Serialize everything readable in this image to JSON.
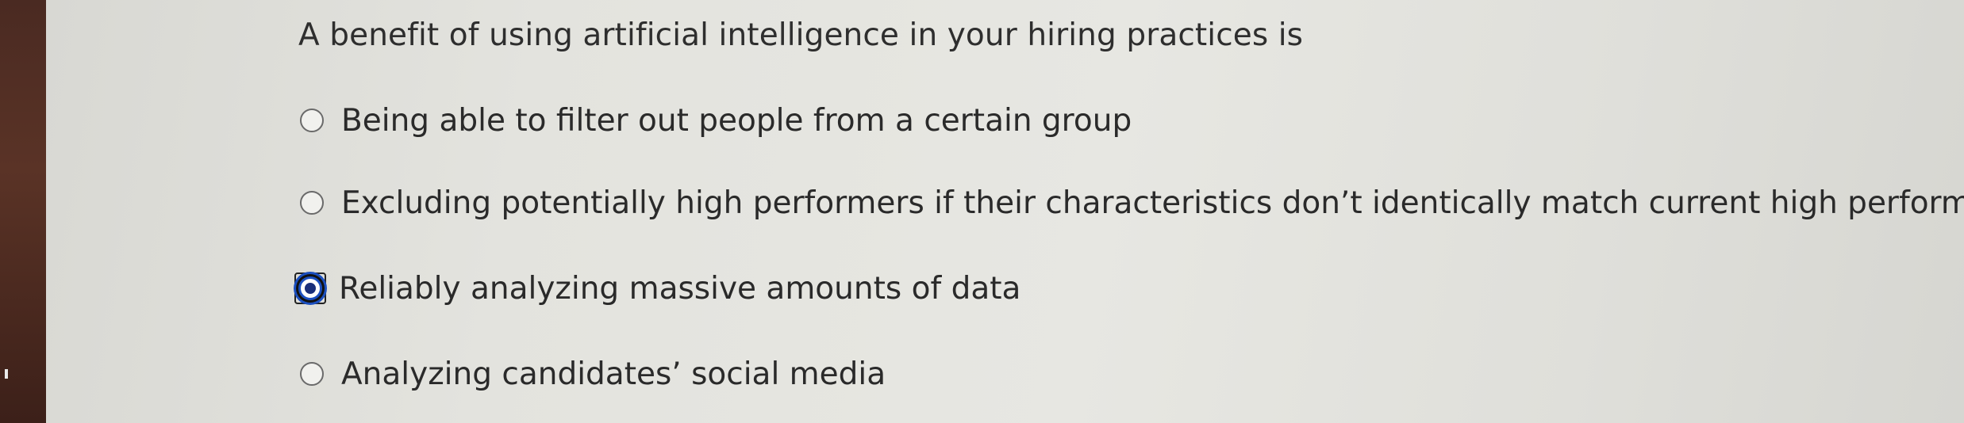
{
  "question": {
    "text": "A benefit of using artificial intelligence in your hiring practices is"
  },
  "options": [
    {
      "label": "Being able to filter out people from a certain group",
      "selected": false
    },
    {
      "label": "Excluding potentially high performers if their characteristics don’t identically match current high performer",
      "selected": false
    },
    {
      "label": "Reliably analyzing massive amounts of data",
      "selected": true
    },
    {
      "label": "Analyzing candidates’ social media",
      "selected": false
    }
  ]
}
